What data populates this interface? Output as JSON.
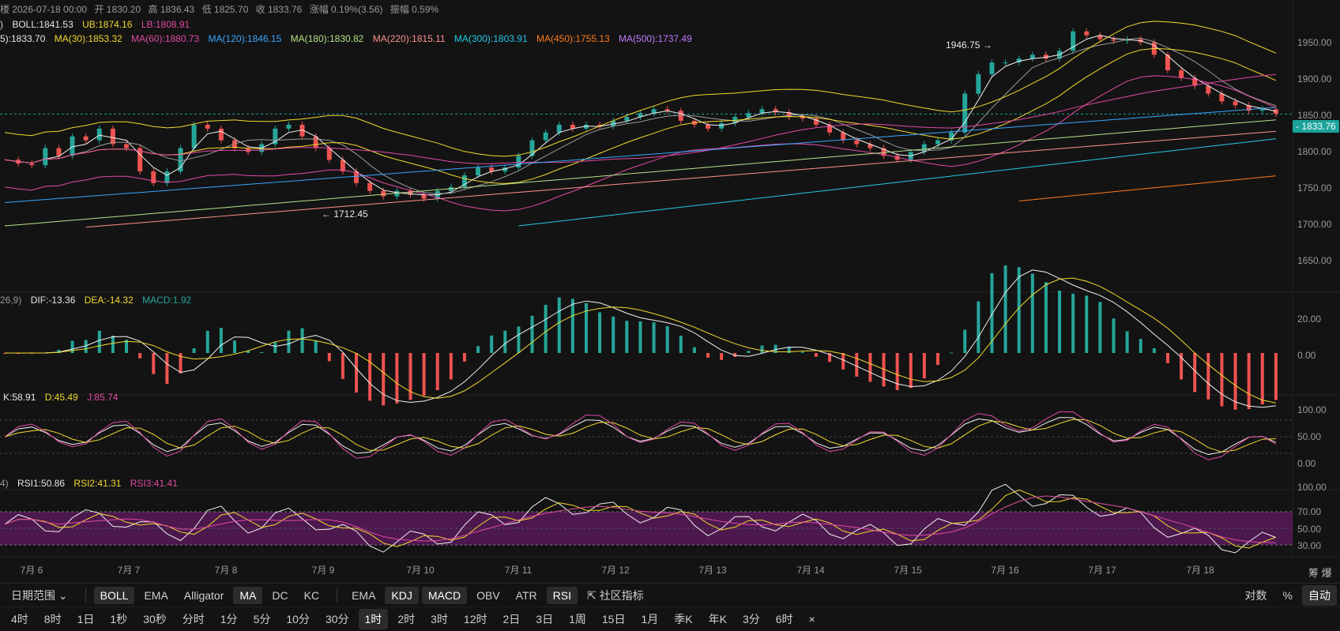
{
  "header": {
    "ohlc": [
      "楼 2026-07-18 00:00",
      "开 1830.20",
      "高 1836.43",
      "低 1825.70",
      "收 1833.76",
      "涨幅 0.19%(3.56)",
      "振幅 0.59%"
    ]
  },
  "legends": {
    "boll": [
      "BOLL:1841.53",
      "UB:1874.16",
      "LB:1808.91"
    ],
    "ma": [
      "5):1833.70",
      "MA(30):1853.32",
      "MA(60):1880.73",
      "MA(120):1846.15",
      "MA(180):1830.82",
      "MA(220):1815.11",
      "MA(300):1803.91",
      "MA(450):1755.13",
      "MA(500):1737.49"
    ],
    "macd": [
      "26,9)",
      "DIF:-13.36",
      "DEA:-14.32",
      "MACD:1.92"
    ],
    "kdj": [
      "K:58.91",
      "D:45.49",
      "J:85.74"
    ],
    "rsi": [
      "4)",
      "RSI1:50.86",
      "RSI2:41.31",
      "RSI3:41.41"
    ]
  },
  "colors": {
    "up": "#26a69a",
    "down": "#ef5350",
    "boll_mid": "#f0f0f0",
    "boll_ub": "#f2d92e",
    "boll_lb": "#e24aa4",
    "ma30": "#f2d92e",
    "ma60": "#e24aa4",
    "ma120": "#38a6ff",
    "ma180": "#b7e08a",
    "ma220": "#ff8f8f",
    "ma300": "#23c8e6",
    "ma450": "#ff7a1a",
    "ma500": "#c07cff",
    "rsi_band": "#5b1a5e",
    "last_price": "#1aa39a"
  },
  "price_axis": [
    "1950.00",
    "1900.00",
    "1850.00",
    "1800.00",
    "1750.00",
    "1700.00",
    "1650.00"
  ],
  "last_price": "1833.76",
  "annotations": {
    "high": "1946.75 →",
    "low": "← 1712.45"
  },
  "macd_axis": [
    "20.00",
    "0.00"
  ],
  "kdj_axis": [
    "100.00",
    "50.00",
    "0.00"
  ],
  "rsi_axis": [
    "100.00",
    "70.00",
    "50.00",
    "30.00"
  ],
  "time_axis": [
    "7月 6",
    "7月 7",
    "7月 8",
    "7月 9",
    "7月 10",
    "7月 11",
    "7月 12",
    "7月 13",
    "7月 14",
    "7月 15",
    "7月 16",
    "7月 17",
    "7月 18"
  ],
  "corner_label": "筹 爆",
  "chart_data": {
    "type": "candlestick",
    "interval": "1时",
    "price_range": [
      1620,
      1960
    ],
    "price_points": [
      1775,
      1770,
      1768,
      1790,
      1780,
      1805,
      1800,
      1815,
      1795,
      1790,
      1760,
      1745,
      1760,
      1790,
      1820,
      1815,
      1800,
      1790,
      1785,
      1795,
      1815,
      1820,
      1805,
      1790,
      1775,
      1760,
      1745,
      1735,
      1728,
      1735,
      1730,
      1725,
      1735,
      1740,
      1755,
      1765,
      1760,
      1765,
      1780,
      1800,
      1810,
      1820,
      1815,
      1820,
      1818,
      1825,
      1830,
      1835,
      1840,
      1838,
      1825,
      1820,
      1815,
      1822,
      1830,
      1835,
      1840,
      1836,
      1830,
      1828,
      1820,
      1810,
      1800,
      1795,
      1790,
      1780,
      1775,
      1785,
      1795,
      1800,
      1810,
      1860,
      1885,
      1900,
      1900,
      1905,
      1910,
      1905,
      1915,
      1940,
      1935,
      1930,
      1928,
      1930,
      1926,
      1910,
      1890,
      1880,
      1870,
      1860,
      1850,
      1845,
      1838,
      1840,
      1834
    ],
    "high": 1946.75,
    "low": 1712.45,
    "last_close": 1833.76,
    "ma_values": {
      "MA(30)": 1853.32,
      "MA(60)": 1880.73,
      "MA(120)": 1846.15,
      "MA(180)": 1830.82,
      "MA(220)": 1815.11,
      "MA(300)": 1803.91,
      "MA(450)": 1755.13,
      "MA(500)": 1737.49
    },
    "boll": {
      "mid": 1841.53,
      "ub": 1874.16,
      "lb": 1808.91
    },
    "macd": {
      "dif": -13.36,
      "dea": -14.32,
      "macd": 1.92
    },
    "kdj": {
      "k": 58.91,
      "d": 45.49,
      "j": 85.74
    },
    "rsi": {
      "rsi1": 50.86,
      "rsi2": 41.31,
      "rsi3": 41.41
    }
  },
  "toolbar1": {
    "range": "日期范围",
    "main": [
      {
        "label": "BOLL",
        "active": true
      },
      {
        "label": "EMA",
        "active": false
      },
      {
        "label": "Alligator",
        "active": false
      },
      {
        "label": "MA",
        "active": true
      },
      {
        "label": "DC",
        "active": false
      },
      {
        "label": "KC",
        "active": false
      }
    ],
    "sub": [
      {
        "label": "EMA",
        "active": false
      },
      {
        "label": "KDJ",
        "active": true
      },
      {
        "label": "MACD",
        "active": true
      },
      {
        "label": "OBV",
        "active": false
      },
      {
        "label": "ATR",
        "active": false
      },
      {
        "label": "RSI",
        "active": true
      }
    ],
    "community": "社区指标",
    "right": [
      "对数",
      "%",
      "自动"
    ]
  },
  "toolbar2": {
    "intervals": [
      "4时",
      "8时",
      "1日",
      "1秒",
      "30秒",
      "分时",
      "1分",
      "5分",
      "10分",
      "30分",
      "1时",
      "2时",
      "3时",
      "12时",
      "2日",
      "3日",
      "1周",
      "15日",
      "1月",
      "季K",
      "年K",
      "3分",
      "6时"
    ],
    "active": "1时",
    "close": "×"
  }
}
